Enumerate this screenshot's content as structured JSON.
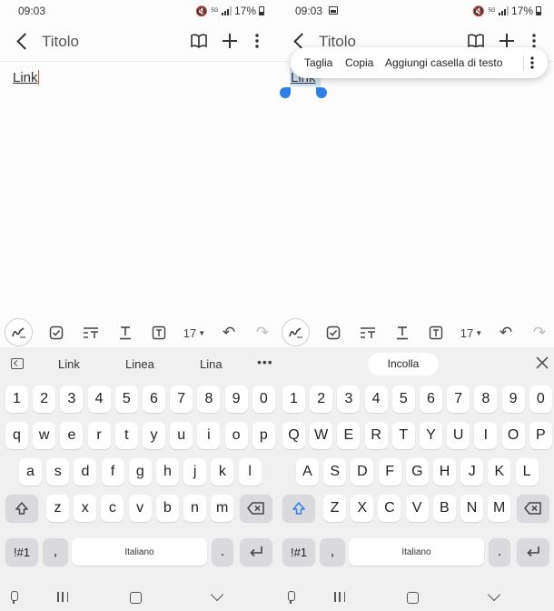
{
  "left": {
    "status": {
      "time": "09:03",
      "net": "5G",
      "battery": "17%"
    },
    "appbar": {
      "title": "Titolo"
    },
    "note_text": "Link",
    "toolbar": {
      "font_size": "17"
    },
    "suggestions": [
      "Link",
      "Linea",
      "Lina"
    ],
    "keys": {
      "numbers": [
        "1",
        "2",
        "3",
        "4",
        "5",
        "6",
        "7",
        "8",
        "9",
        "0"
      ],
      "row1": [
        "q",
        "w",
        "e",
        "r",
        "t",
        "y",
        "u",
        "i",
        "o",
        "p"
      ],
      "row2": [
        "a",
        "s",
        "d",
        "f",
        "g",
        "h",
        "j",
        "k",
        "l"
      ],
      "row3": [
        "z",
        "x",
        "c",
        "v",
        "b",
        "n",
        "m"
      ],
      "symbols": "!#1",
      "comma": ",",
      "space": "Italiano",
      "period": "."
    }
  },
  "right": {
    "status": {
      "time": "09:03",
      "net": "5G",
      "battery": "17%"
    },
    "appbar": {
      "title": "Titolo"
    },
    "note_text": "Link",
    "context_menu": [
      "Taglia",
      "Copia",
      "Aggiungi casella di testo"
    ],
    "toolbar": {
      "font_size": "17"
    },
    "paste_label": "Incolla",
    "keys": {
      "numbers": [
        "1",
        "2",
        "3",
        "4",
        "5",
        "6",
        "7",
        "8",
        "9",
        "0"
      ],
      "row1": [
        "Q",
        "W",
        "E",
        "R",
        "T",
        "Y",
        "U",
        "I",
        "O",
        "P"
      ],
      "row2": [
        "A",
        "S",
        "D",
        "F",
        "G",
        "H",
        "J",
        "K",
        "L"
      ],
      "row3": [
        "Z",
        "X",
        "C",
        "V",
        "B",
        "N",
        "M"
      ],
      "symbols": "!#1",
      "comma": ",",
      "space": "Italiano",
      "period": "."
    }
  }
}
